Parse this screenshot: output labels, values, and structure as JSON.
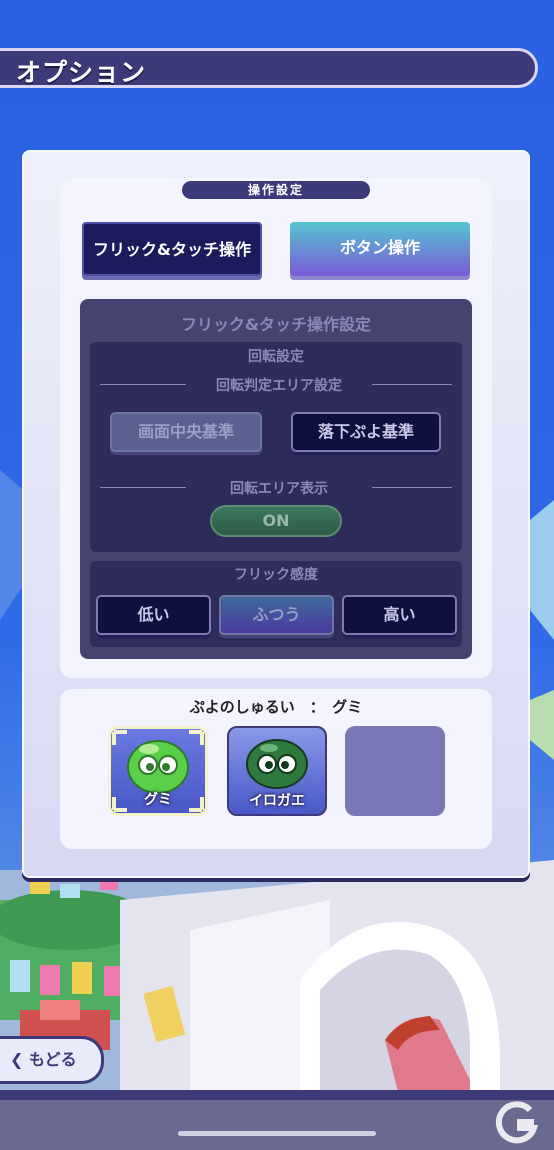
{
  "header": {
    "title": "オプション"
  },
  "controls": {
    "section_label": "操作設定",
    "flick_touch_label": "フリック&タッチ操作",
    "button_label": "ボタン操作"
  },
  "flick_settings": {
    "title": "フリック&タッチ操作設定",
    "rotation": {
      "title": "回転設定",
      "area_label": "回転判定エリア設定",
      "option_center": "画面中央基準",
      "option_falling": "落下ぷよ基準",
      "display_label": "回転エリア表示",
      "display_toggle": "ON"
    },
    "sensitivity": {
      "title": "フリック感度",
      "low": "低い",
      "normal": "ふつう",
      "high": "高い"
    }
  },
  "puyo_type": {
    "label": "ぷよのしゅるい　：　グミ",
    "options": [
      {
        "name": "グミ",
        "icon": "green-gummi-puyo-icon",
        "color": "#5ad04a"
      },
      {
        "name": "イロガエ",
        "icon": "dark-green-puyo-icon",
        "color": "#2e7a3e"
      },
      {
        "name": "",
        "icon": "",
        "color": "#7a78b4"
      }
    ]
  },
  "footer": {
    "back_label": "もどる"
  }
}
